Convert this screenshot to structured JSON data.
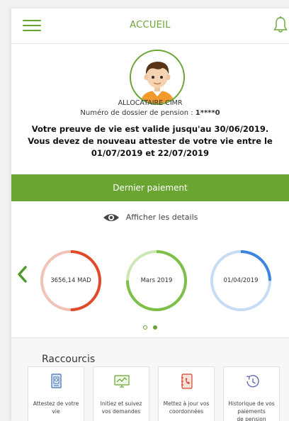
{
  "header": {
    "title": "ACCUEIL",
    "menu_icon": "hamburger-icon",
    "notification_icon": "bell-icon"
  },
  "profile": {
    "avatar_icon": "user-avatar-icon",
    "role": "ALLOCATAIRE CIMR",
    "dossier_label": "Numéro de dossier de pension : ",
    "dossier_number": "1****0",
    "validity_line1": "Votre preuve de vie est valide jusqu'au 30/06/2019.",
    "validity_line2": "Vous devez de nouveau attester de votre vie entre le",
    "validity_line3": "01/07/2019 et 22/07/2019"
  },
  "payment": {
    "title": "Dernier paiement",
    "details_label": "Afficher les details",
    "details_icon": "eye-icon",
    "prev_icon": "chevron-left-icon",
    "circles": [
      {
        "value": "3656,14 MAD",
        "color": "#e04a2a",
        "track": "#f3c2b6",
        "progress": 0.5
      },
      {
        "value": "Mars 2019",
        "color": "#7cc04a",
        "track": "#cbe8b4",
        "progress": 0.75
      },
      {
        "value": "01/04/2019",
        "color": "#3d84e0",
        "track": "#c6dcf6",
        "progress": 0.25
      }
    ],
    "pagination": {
      "total": 2,
      "active": 2
    }
  },
  "shortcuts": {
    "title": "Raccourcis",
    "items": [
      {
        "icon": "attestation-document-icon",
        "label_lines": [
          "Attestez de votre",
          "vie"
        ]
      },
      {
        "icon": "monitor-chart-icon",
        "label_lines": [
          "Initiez et suivez",
          "vos demandes"
        ]
      },
      {
        "icon": "address-book-icon",
        "label_lines": [
          "Mettez à jour vos",
          "coordonnées"
        ]
      },
      {
        "icon": "history-clock-icon",
        "label_lines": [
          "Historique de vos",
          "paiements",
          "de pension"
        ]
      }
    ]
  },
  "colors": {
    "brand_green": "#6aa532",
    "text_dark": "#111111"
  }
}
